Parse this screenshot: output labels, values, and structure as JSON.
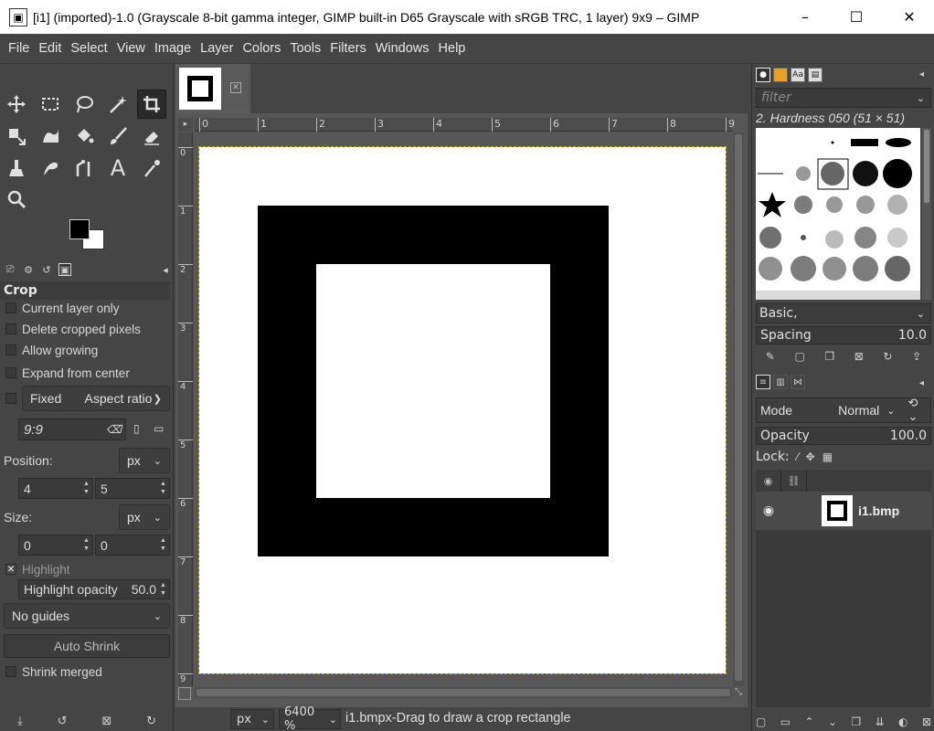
{
  "window": {
    "title": "[i1] (imported)-1.0 (Grayscale 8-bit gamma integer, GIMP built-in D65 Grayscale with sRGB TRC, 1 layer) 9x9 – GIMP",
    "minimize": "–",
    "maximize": "☐",
    "close": "✕"
  },
  "menu": [
    "File",
    "Edit",
    "Select",
    "View",
    "Image",
    "Layer",
    "Colors",
    "Tools",
    "Filters",
    "Windows",
    "Help"
  ],
  "toolbox": {
    "tools": [
      {
        "name": "move-tool-icon",
        "glyph": "✥"
      },
      {
        "name": "rect-select-tool-icon",
        "glyph": "⬚"
      },
      {
        "name": "lasso-tool-icon",
        "glyph": "ᑕ"
      },
      {
        "name": "fuzzy-select-tool-icon",
        "glyph": "✎"
      },
      {
        "name": "crop-tool-icon",
        "glyph": "⌗"
      },
      {
        "name": "transform-tool-icon",
        "glyph": "⇲"
      },
      {
        "name": "warp-tool-icon",
        "glyph": "◠"
      },
      {
        "name": "bucket-fill-tool-icon",
        "glyph": "◈"
      },
      {
        "name": "paintbrush-tool-icon",
        "glyph": "⁄"
      },
      {
        "name": "eraser-tool-icon",
        "glyph": "▱"
      },
      {
        "name": "clone-tool-icon",
        "glyph": "⍊"
      },
      {
        "name": "smudge-tool-icon",
        "glyph": "ᘛ"
      },
      {
        "name": "paths-tool-icon",
        "glyph": "⌇"
      },
      {
        "name": "text-tool-icon",
        "glyph": "A"
      },
      {
        "name": "color-picker-tool-icon",
        "glyph": "⁄"
      },
      {
        "name": "zoom-tool-icon",
        "glyph": "⚲"
      }
    ]
  },
  "tool_options": {
    "title": "Crop",
    "current_layer_only": "Current layer only",
    "delete_cropped": "Delete cropped pixels",
    "allow_growing": "Allow growing",
    "expand_from_center": "Expand from center",
    "fixed_label": "Fixed",
    "fixed_value": "Aspect ratio",
    "ratio_value": "9:9",
    "position_label": "Position:",
    "position_unit": "px",
    "position_x": "4",
    "position_y": "5",
    "size_label": "Size:",
    "size_unit": "px",
    "size_w": "0",
    "size_h": "0",
    "highlight": "Highlight",
    "highlight_opacity_label": "Highlight opacity",
    "highlight_opacity_value": "50.0",
    "guides": "No guides",
    "auto_shrink": "Auto Shrink",
    "shrink_merged": "Shrink merged"
  },
  "ruler": {
    "h_ticks": [
      "0",
      "1",
      "2",
      "3",
      "4",
      "5",
      "6",
      "7",
      "8",
      "9"
    ],
    "v_ticks": [
      "0",
      "1",
      "2",
      "3",
      "4",
      "5",
      "6",
      "7",
      "8",
      "9"
    ]
  },
  "statusbar": {
    "unit": "px",
    "zoom": "6400 %",
    "message": "i1.bmpx-Drag to draw a crop rectangle"
  },
  "brushes": {
    "filter_placeholder": "filter",
    "brush_name": "2. Hardness 050 (51 × 51)",
    "brush_set": "Basic,",
    "spacing_label": "Spacing",
    "spacing_value": "10.0"
  },
  "layers": {
    "mode_label": "Mode",
    "mode_value": "Normal",
    "opacity_label": "Opacity",
    "opacity_value": "100.0",
    "lock_label": "Lock:",
    "items": [
      {
        "name": "i1.bmp"
      }
    ]
  }
}
